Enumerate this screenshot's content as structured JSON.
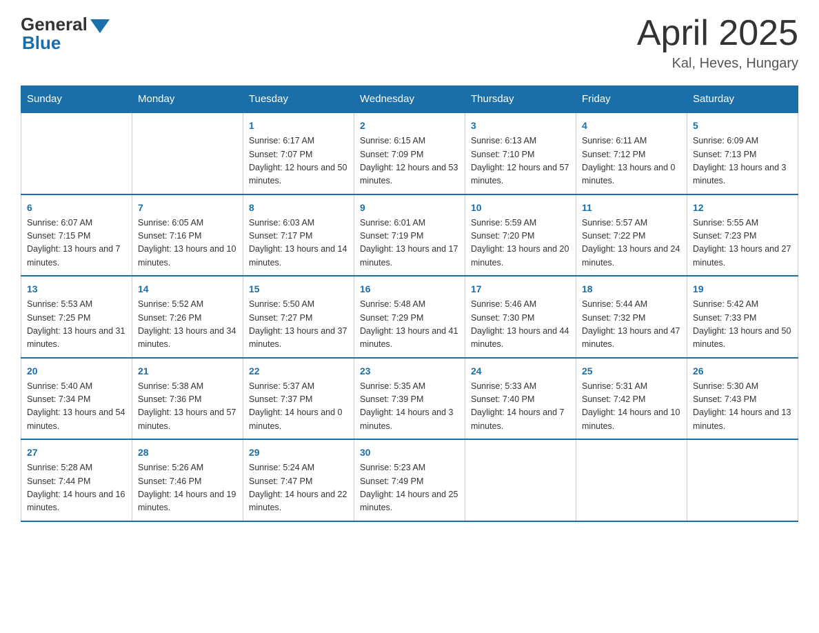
{
  "header": {
    "logo_general": "General",
    "logo_blue": "Blue",
    "month": "April 2025",
    "location": "Kal, Heves, Hungary"
  },
  "days_of_week": [
    "Sunday",
    "Monday",
    "Tuesday",
    "Wednesday",
    "Thursday",
    "Friday",
    "Saturday"
  ],
  "weeks": [
    [
      {
        "day": "",
        "sunrise": "",
        "sunset": "",
        "daylight": ""
      },
      {
        "day": "",
        "sunrise": "",
        "sunset": "",
        "daylight": ""
      },
      {
        "day": "1",
        "sunrise": "Sunrise: 6:17 AM",
        "sunset": "Sunset: 7:07 PM",
        "daylight": "Daylight: 12 hours and 50 minutes."
      },
      {
        "day": "2",
        "sunrise": "Sunrise: 6:15 AM",
        "sunset": "Sunset: 7:09 PM",
        "daylight": "Daylight: 12 hours and 53 minutes."
      },
      {
        "day": "3",
        "sunrise": "Sunrise: 6:13 AM",
        "sunset": "Sunset: 7:10 PM",
        "daylight": "Daylight: 12 hours and 57 minutes."
      },
      {
        "day": "4",
        "sunrise": "Sunrise: 6:11 AM",
        "sunset": "Sunset: 7:12 PM",
        "daylight": "Daylight: 13 hours and 0 minutes."
      },
      {
        "day": "5",
        "sunrise": "Sunrise: 6:09 AM",
        "sunset": "Sunset: 7:13 PM",
        "daylight": "Daylight: 13 hours and 3 minutes."
      }
    ],
    [
      {
        "day": "6",
        "sunrise": "Sunrise: 6:07 AM",
        "sunset": "Sunset: 7:15 PM",
        "daylight": "Daylight: 13 hours and 7 minutes."
      },
      {
        "day": "7",
        "sunrise": "Sunrise: 6:05 AM",
        "sunset": "Sunset: 7:16 PM",
        "daylight": "Daylight: 13 hours and 10 minutes."
      },
      {
        "day": "8",
        "sunrise": "Sunrise: 6:03 AM",
        "sunset": "Sunset: 7:17 PM",
        "daylight": "Daylight: 13 hours and 14 minutes."
      },
      {
        "day": "9",
        "sunrise": "Sunrise: 6:01 AM",
        "sunset": "Sunset: 7:19 PM",
        "daylight": "Daylight: 13 hours and 17 minutes."
      },
      {
        "day": "10",
        "sunrise": "Sunrise: 5:59 AM",
        "sunset": "Sunset: 7:20 PM",
        "daylight": "Daylight: 13 hours and 20 minutes."
      },
      {
        "day": "11",
        "sunrise": "Sunrise: 5:57 AM",
        "sunset": "Sunset: 7:22 PM",
        "daylight": "Daylight: 13 hours and 24 minutes."
      },
      {
        "day": "12",
        "sunrise": "Sunrise: 5:55 AM",
        "sunset": "Sunset: 7:23 PM",
        "daylight": "Daylight: 13 hours and 27 minutes."
      }
    ],
    [
      {
        "day": "13",
        "sunrise": "Sunrise: 5:53 AM",
        "sunset": "Sunset: 7:25 PM",
        "daylight": "Daylight: 13 hours and 31 minutes."
      },
      {
        "day": "14",
        "sunrise": "Sunrise: 5:52 AM",
        "sunset": "Sunset: 7:26 PM",
        "daylight": "Daylight: 13 hours and 34 minutes."
      },
      {
        "day": "15",
        "sunrise": "Sunrise: 5:50 AM",
        "sunset": "Sunset: 7:27 PM",
        "daylight": "Daylight: 13 hours and 37 minutes."
      },
      {
        "day": "16",
        "sunrise": "Sunrise: 5:48 AM",
        "sunset": "Sunset: 7:29 PM",
        "daylight": "Daylight: 13 hours and 41 minutes."
      },
      {
        "day": "17",
        "sunrise": "Sunrise: 5:46 AM",
        "sunset": "Sunset: 7:30 PM",
        "daylight": "Daylight: 13 hours and 44 minutes."
      },
      {
        "day": "18",
        "sunrise": "Sunrise: 5:44 AM",
        "sunset": "Sunset: 7:32 PM",
        "daylight": "Daylight: 13 hours and 47 minutes."
      },
      {
        "day": "19",
        "sunrise": "Sunrise: 5:42 AM",
        "sunset": "Sunset: 7:33 PM",
        "daylight": "Daylight: 13 hours and 50 minutes."
      }
    ],
    [
      {
        "day": "20",
        "sunrise": "Sunrise: 5:40 AM",
        "sunset": "Sunset: 7:34 PM",
        "daylight": "Daylight: 13 hours and 54 minutes."
      },
      {
        "day": "21",
        "sunrise": "Sunrise: 5:38 AM",
        "sunset": "Sunset: 7:36 PM",
        "daylight": "Daylight: 13 hours and 57 minutes."
      },
      {
        "day": "22",
        "sunrise": "Sunrise: 5:37 AM",
        "sunset": "Sunset: 7:37 PM",
        "daylight": "Daylight: 14 hours and 0 minutes."
      },
      {
        "day": "23",
        "sunrise": "Sunrise: 5:35 AM",
        "sunset": "Sunset: 7:39 PM",
        "daylight": "Daylight: 14 hours and 3 minutes."
      },
      {
        "day": "24",
        "sunrise": "Sunrise: 5:33 AM",
        "sunset": "Sunset: 7:40 PM",
        "daylight": "Daylight: 14 hours and 7 minutes."
      },
      {
        "day": "25",
        "sunrise": "Sunrise: 5:31 AM",
        "sunset": "Sunset: 7:42 PM",
        "daylight": "Daylight: 14 hours and 10 minutes."
      },
      {
        "day": "26",
        "sunrise": "Sunrise: 5:30 AM",
        "sunset": "Sunset: 7:43 PM",
        "daylight": "Daylight: 14 hours and 13 minutes."
      }
    ],
    [
      {
        "day": "27",
        "sunrise": "Sunrise: 5:28 AM",
        "sunset": "Sunset: 7:44 PM",
        "daylight": "Daylight: 14 hours and 16 minutes."
      },
      {
        "day": "28",
        "sunrise": "Sunrise: 5:26 AM",
        "sunset": "Sunset: 7:46 PM",
        "daylight": "Daylight: 14 hours and 19 minutes."
      },
      {
        "day": "29",
        "sunrise": "Sunrise: 5:24 AM",
        "sunset": "Sunset: 7:47 PM",
        "daylight": "Daylight: 14 hours and 22 minutes."
      },
      {
        "day": "30",
        "sunrise": "Sunrise: 5:23 AM",
        "sunset": "Sunset: 7:49 PM",
        "daylight": "Daylight: 14 hours and 25 minutes."
      },
      {
        "day": "",
        "sunrise": "",
        "sunset": "",
        "daylight": ""
      },
      {
        "day": "",
        "sunrise": "",
        "sunset": "",
        "daylight": ""
      },
      {
        "day": "",
        "sunrise": "",
        "sunset": "",
        "daylight": ""
      }
    ]
  ]
}
